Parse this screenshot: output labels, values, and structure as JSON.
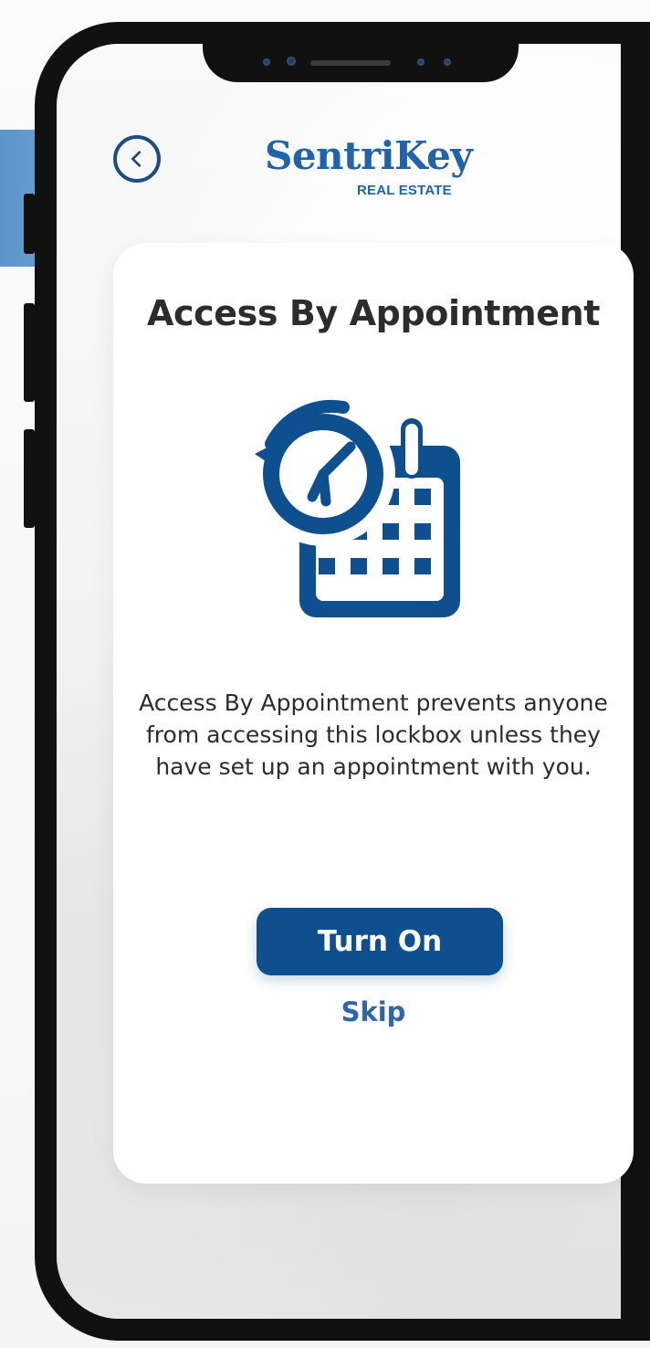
{
  "screen": {
    "title": "Access By Appointment",
    "description": "Access By Appointment prevents anyone from accessing this lockbox unless they have set up an appointment with you.",
    "primary_button_label": "Turn On",
    "secondary_link_label": "Skip"
  },
  "header": {
    "brand_title": "SentriKey",
    "brand_subtitle": "REAL ESTATE",
    "back_icon": "chevron-left-icon"
  },
  "colors": {
    "brand_blue": "#1F63AD",
    "button_blue": "#0D4F8F",
    "text_dark": "#2C2C2C",
    "accent_left_block": "#6A9ED0"
  },
  "icons": {
    "main_illustration": "appointment-calendar-clock-icon"
  }
}
